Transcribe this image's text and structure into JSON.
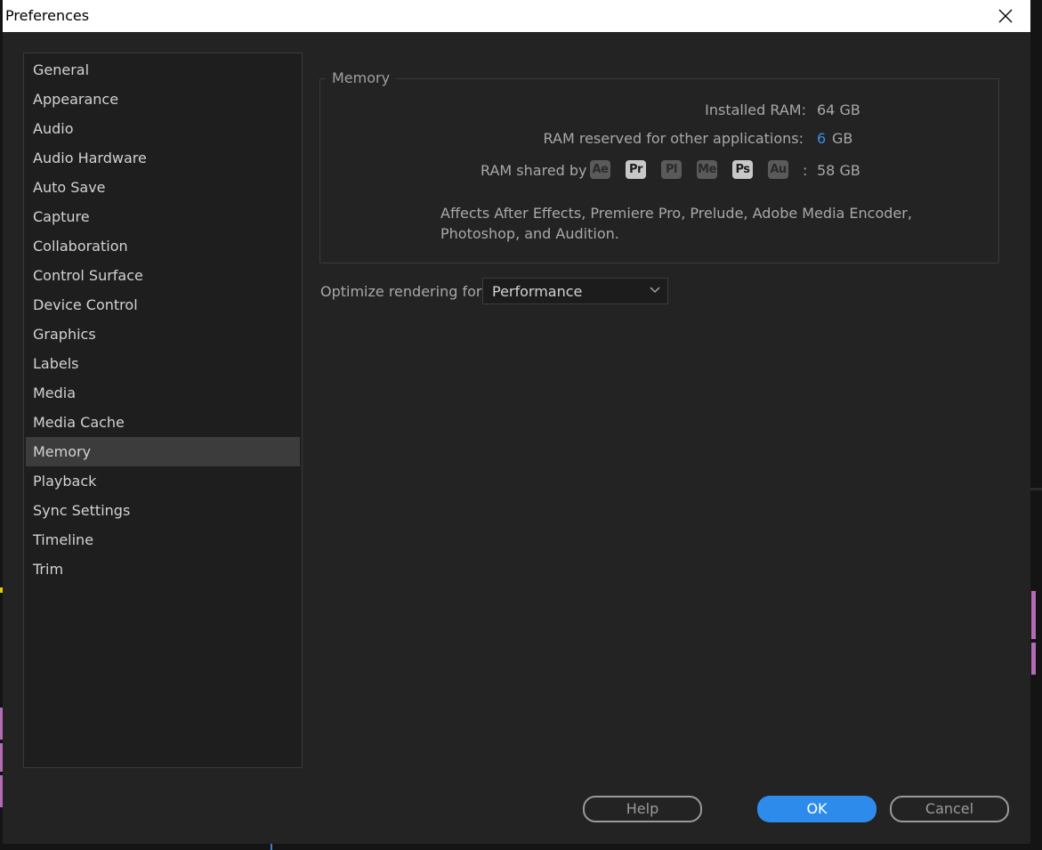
{
  "window": {
    "title": "Preferences",
    "close_icon": "close-icon"
  },
  "sidebar": {
    "selected": "Memory",
    "items": [
      {
        "label": "General"
      },
      {
        "label": "Appearance"
      },
      {
        "label": "Audio"
      },
      {
        "label": "Audio Hardware"
      },
      {
        "label": "Auto Save"
      },
      {
        "label": "Capture"
      },
      {
        "label": "Collaboration"
      },
      {
        "label": "Control Surface"
      },
      {
        "label": "Device Control"
      },
      {
        "label": "Graphics"
      },
      {
        "label": "Labels"
      },
      {
        "label": "Media"
      },
      {
        "label": "Media Cache"
      },
      {
        "label": "Memory"
      },
      {
        "label": "Playback"
      },
      {
        "label": "Sync Settings"
      },
      {
        "label": "Timeline"
      },
      {
        "label": "Trim"
      }
    ]
  },
  "memory": {
    "group_title": "Memory",
    "installed_label": "Installed RAM:",
    "installed_value": "64 GB",
    "reserved_label": "RAM reserved for other applications:",
    "reserved_value": "6",
    "reserved_unit": "GB",
    "shared_label": "RAM shared by",
    "apps": [
      {
        "abbr": "Ae",
        "active": false
      },
      {
        "abbr": "Pr",
        "active": true
      },
      {
        "abbr": "Pl",
        "active": false
      },
      {
        "abbr": "Me",
        "active": false
      },
      {
        "abbr": "Ps",
        "active": true
      },
      {
        "abbr": "Au",
        "active": false
      }
    ],
    "shared_separator": ":",
    "shared_value": "58 GB",
    "note_line1": "Affects After Effects, Premiere Pro, Prelude, Adobe Media Encoder,",
    "note_line2": "Photoshop, and Audition."
  },
  "rendering": {
    "label": "Optimize rendering for:",
    "value": "Performance",
    "arrow_icon": "chevron-down-icon"
  },
  "buttons": {
    "help": "Help",
    "ok": "OK",
    "cancel": "Cancel"
  },
  "colors": {
    "accent": "#2d8ceb",
    "link_value": "#3a8fe6",
    "dialog_bg": "#232323",
    "selected_item_bg": "#3c3c3c"
  }
}
